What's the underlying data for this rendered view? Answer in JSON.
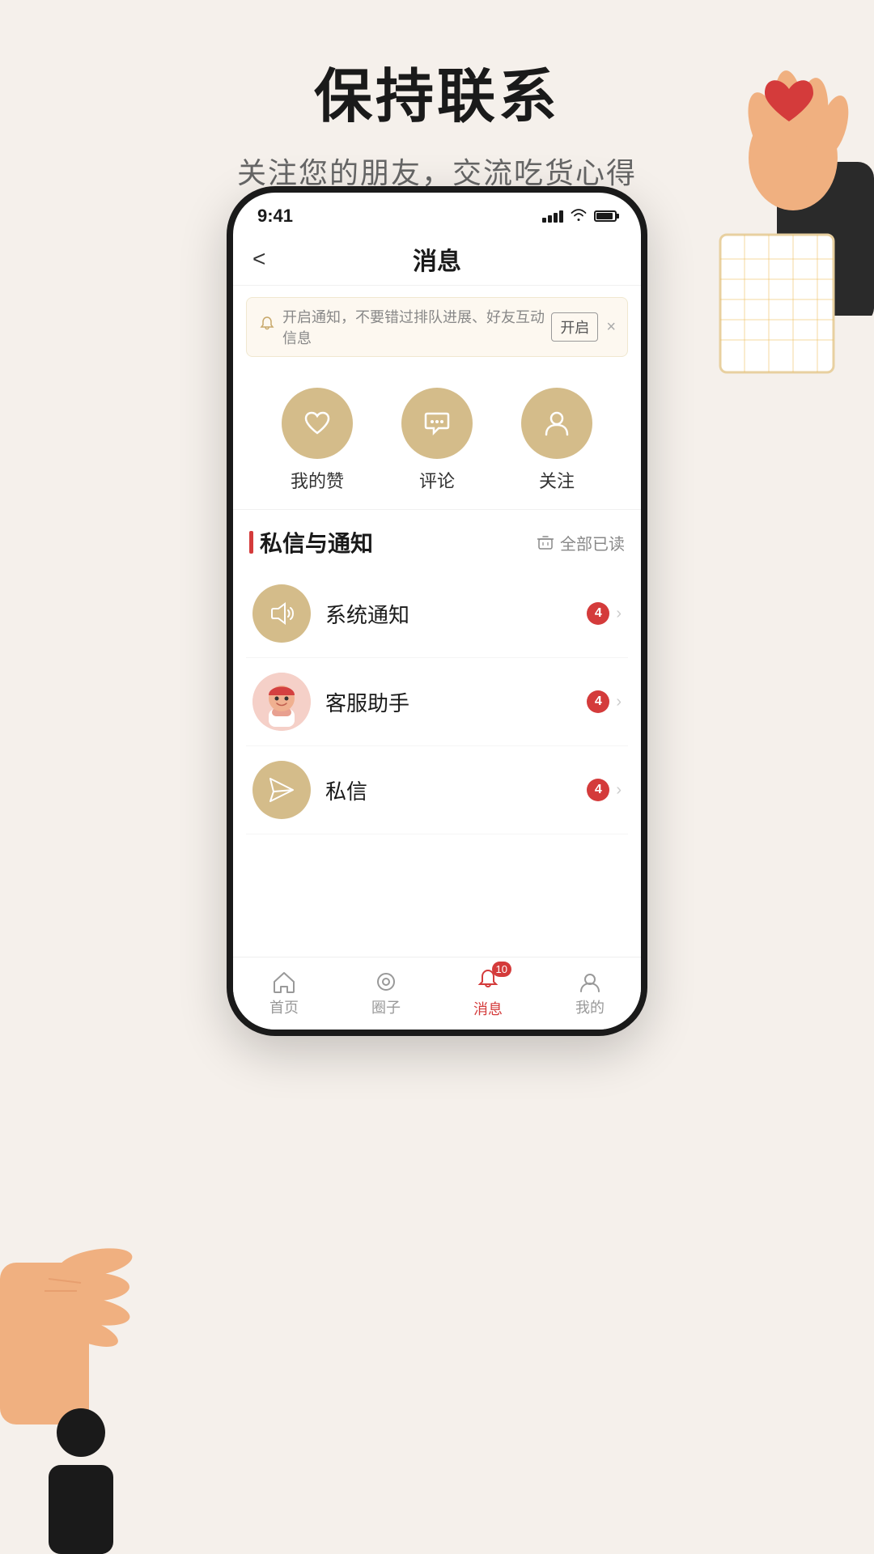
{
  "page": {
    "title": "保持联系",
    "subtitle": "关注您的朋友，交流吃货心得"
  },
  "status_bar": {
    "time": "9:41"
  },
  "nav": {
    "back_label": "<",
    "title": "消息"
  },
  "notification_banner": {
    "text": "开启通知，不要错过排队进展、好友互动信息",
    "enable_label": "开启",
    "close_label": "×"
  },
  "quick_actions": [
    {
      "icon": "♡",
      "label": "我的赞"
    },
    {
      "icon": "💬",
      "label": "评论"
    },
    {
      "icon": "👤",
      "label": "关注"
    }
  ],
  "section": {
    "title": "私信与通知",
    "mark_read": "全部已读"
  },
  "messages": [
    {
      "name": "系统通知",
      "badge": "4",
      "icon": "📢",
      "type": "speaker"
    },
    {
      "name": "客服助手",
      "badge": "4",
      "icon": "🧑‍💼",
      "type": "service"
    },
    {
      "name": "私信",
      "badge": "4",
      "icon": "✈",
      "type": "letter"
    }
  ],
  "tabs": [
    {
      "icon": "⌂",
      "label": "首页",
      "active": false,
      "badge": null
    },
    {
      "icon": "◎",
      "label": "圈子",
      "active": false,
      "badge": null
    },
    {
      "icon": "🔔",
      "label": "消息",
      "active": true,
      "badge": "10"
    },
    {
      "icon": "☺",
      "label": "我的",
      "active": false,
      "badge": null
    }
  ]
}
